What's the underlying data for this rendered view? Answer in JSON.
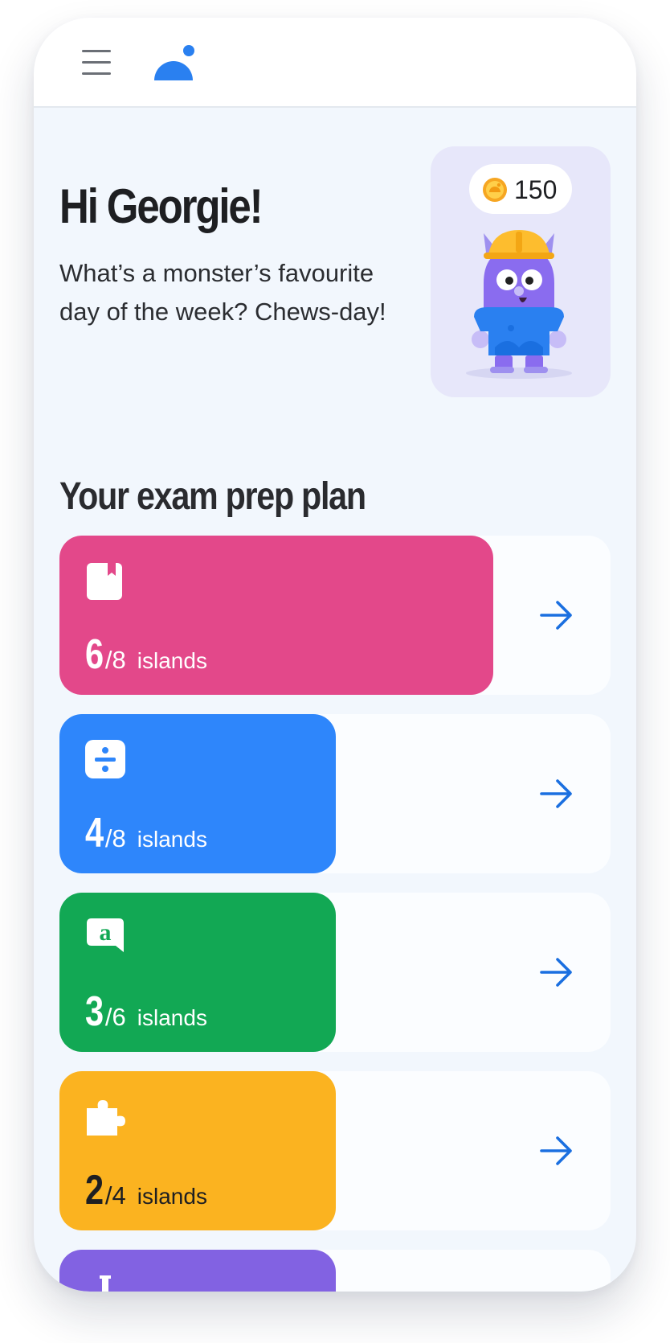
{
  "header": {
    "menu_icon": "hamburger-menu-icon",
    "logo_icon": "brand-logo-icon"
  },
  "greeting": {
    "title": "Hi Georgie!",
    "joke": "What’s a monster’s favourite day of the week? Chews-day!"
  },
  "profile": {
    "coins": "150",
    "coin_icon": "coin-icon",
    "avatar": "monster-avatar"
  },
  "plan": {
    "title": "Your exam prep plan",
    "subjects": [
      {
        "icon": "book-icon",
        "completed": "6",
        "total": "/8",
        "unit": "islands",
        "progress": 0.75,
        "color": "#e3488a",
        "text_color": "#ffffff"
      },
      {
        "icon": "division-icon",
        "completed": "4",
        "total": "/8",
        "unit": "islands",
        "progress": 0.5,
        "color": "#2e86fb",
        "text_color": "#ffffff"
      },
      {
        "icon": "speech-a-icon",
        "completed": "3",
        "total": "/6",
        "unit": "islands",
        "progress": 0.5,
        "color": "#12a854",
        "text_color": "#ffffff"
      },
      {
        "icon": "puzzle-icon",
        "completed": "2",
        "total": "/4",
        "unit": "islands",
        "progress": 0.5,
        "color": "#fbb320",
        "text_color": "#1e1f22"
      },
      {
        "icon": "flask-icon",
        "color": "#8262e2"
      }
    ]
  },
  "colors": {
    "accent_blue": "#2a80f0",
    "arrow": "#1a6fe0",
    "background": "#f2f7fd",
    "profile_card": "#e7e7fa"
  }
}
